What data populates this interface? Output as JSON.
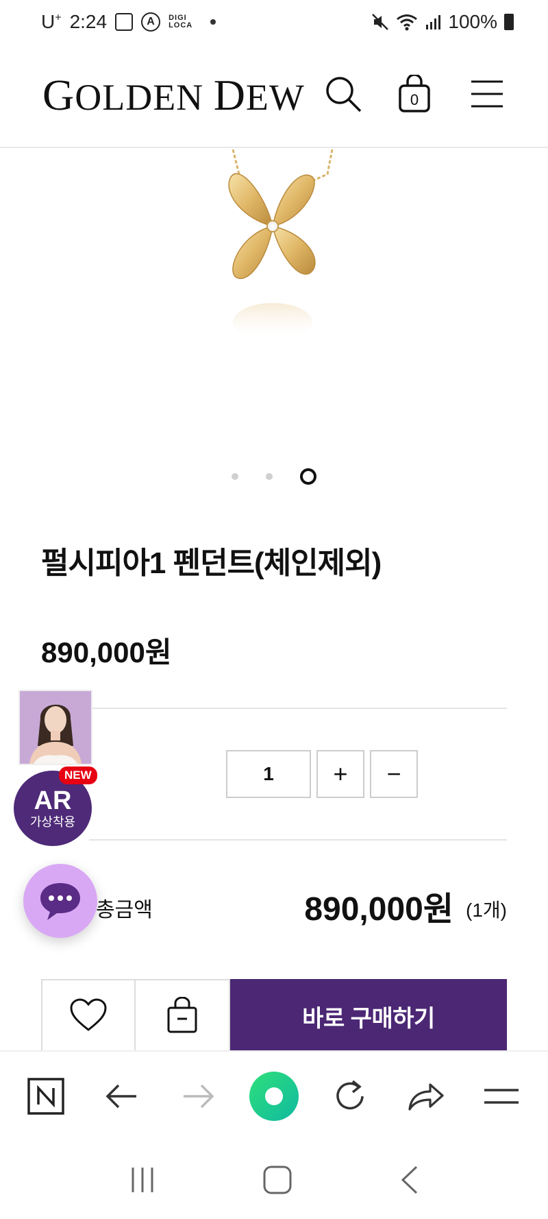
{
  "status_bar": {
    "carrier": "U",
    "carrier_sup": "+",
    "time": "2:24",
    "digi_line1": "DIGI",
    "digi_line2": "LOCA",
    "battery": "100%"
  },
  "header": {
    "logo_g": "G",
    "logo_olden": "OLDEN ",
    "logo_d": "D",
    "logo_ew": "EW"
  },
  "carousel": {
    "total": 3,
    "active_index": 3
  },
  "product": {
    "title": "펄시피아1 펜던트(체인제외)",
    "price": "890,000원"
  },
  "quantity": {
    "value": "1",
    "plus": "+",
    "minus": "−"
  },
  "total": {
    "label": "총금액",
    "amount": "890,000원",
    "count": "(1개)"
  },
  "actions": {
    "buy_now": "바로 구매하기"
  },
  "floating": {
    "ar_main": "AR",
    "ar_sub": "가상착용",
    "new_tag": "NEW"
  },
  "colors": {
    "brand_purple": "#4b2774",
    "chat_bubble": "#d9a8f5",
    "browser_green": "#1ec66e"
  }
}
